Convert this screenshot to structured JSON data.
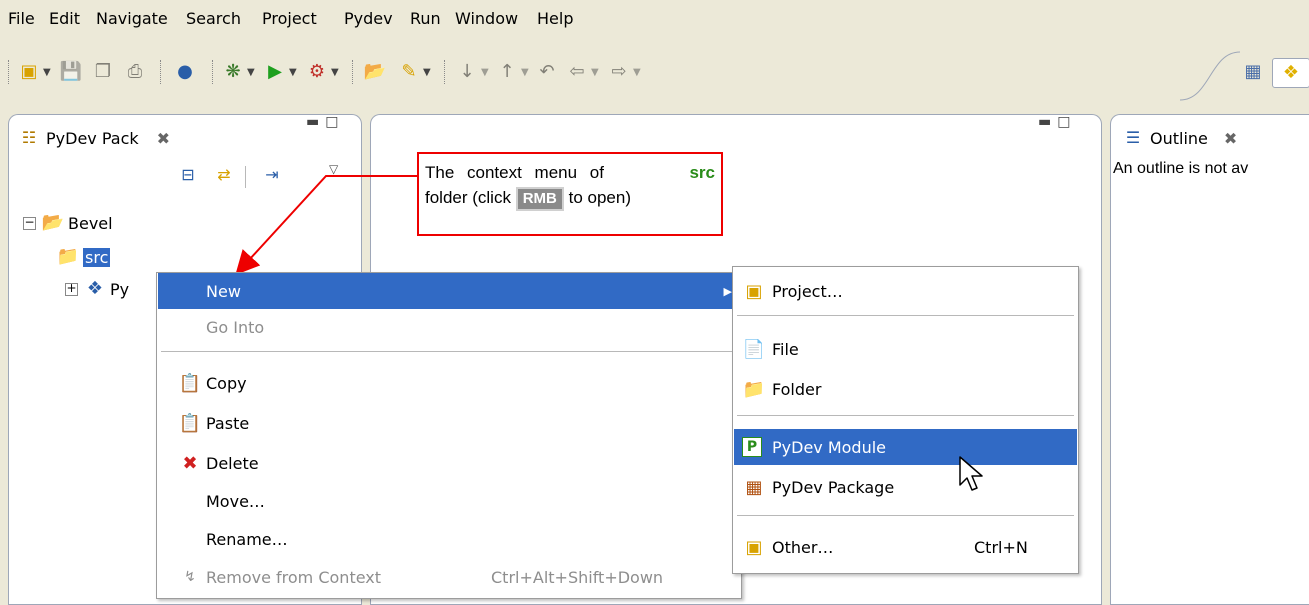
{
  "menubar": [
    "File",
    "Edit",
    "Navigate",
    "Search",
    "Project",
    "Pydev",
    "Run",
    "Window",
    "Help"
  ],
  "explorer": {
    "tab_title": "PyDev Pack",
    "tree": {
      "project": "Bevel",
      "folder": "src",
      "third_partial": "Py"
    }
  },
  "outline": {
    "tab_title": "Outline",
    "message": "An outline is not av"
  },
  "callout": {
    "line1_prefix": "The context menu of",
    "line1_bold": "src",
    "line2_prefix": "folder (click",
    "key": "RMB",
    "line2_suffix": "to open)"
  },
  "context_menu": {
    "new": "New",
    "go_into": "Go Into",
    "copy": "Copy",
    "paste": "Paste",
    "delete": "Delete",
    "move": "Move…",
    "rename": "Rename…",
    "remove_from_context": "Remove from Context",
    "remove_shortcut": "Ctrl+Alt+Shift+Down"
  },
  "submenu": {
    "project": "Project…",
    "file": "File",
    "folder": "Folder",
    "pydev_module": "PyDev Module",
    "pydev_package": "PyDev Package",
    "other": "Other…",
    "other_shortcut": "Ctrl+N"
  },
  "colors": {
    "selection": "#316ac5",
    "callout_border": "#e00000",
    "callout_highlight": "#2a8c1a"
  }
}
